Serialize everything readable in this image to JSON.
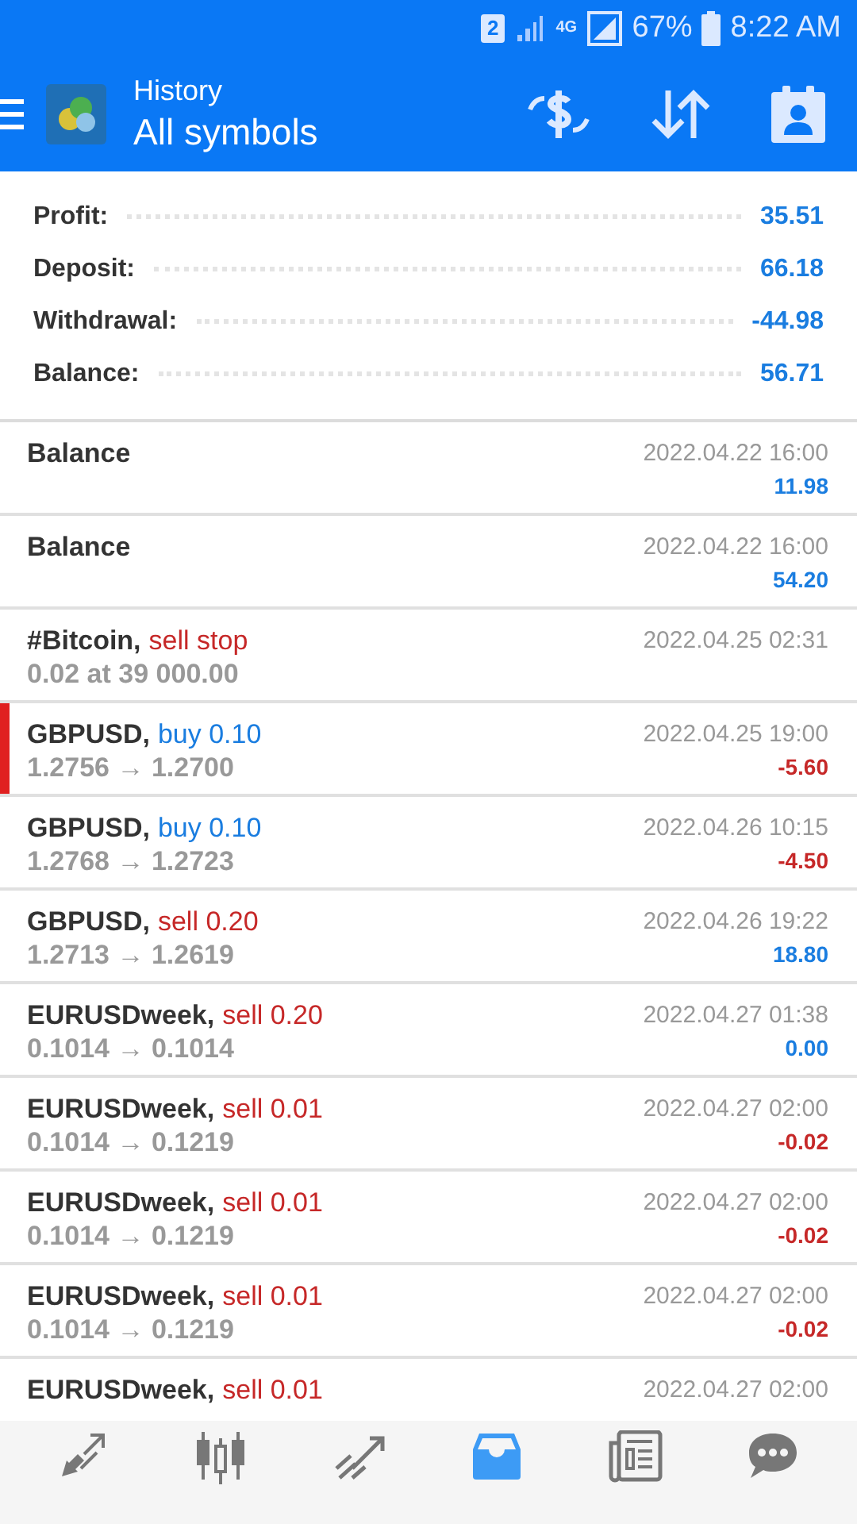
{
  "status_bar": {
    "sim": "2",
    "network": "4G",
    "battery": "67%",
    "time": "8:22 AM"
  },
  "header": {
    "subtitle": "History",
    "title": "All symbols"
  },
  "summary": [
    {
      "label": "Profit:",
      "value": "35.51",
      "negative": false
    },
    {
      "label": "Deposit:",
      "value": "66.18",
      "negative": false
    },
    {
      "label": "Withdrawal:",
      "value": "-44.98",
      "negative": false
    },
    {
      "label": "Balance:",
      "value": "56.71",
      "negative": false
    }
  ],
  "rows": [
    {
      "kind": "balance",
      "symbol": "Balance",
      "time": "2022.04.22 16:00",
      "amount": "11.98",
      "negative": false,
      "selected": false
    },
    {
      "kind": "balance",
      "symbol": "Balance",
      "time": "2022.04.22 16:00",
      "amount": "54.20",
      "negative": false,
      "selected": false
    },
    {
      "kind": "order",
      "symbol": "#Bitcoin,",
      "buy": false,
      "action": "sell stop",
      "details": "0.02 at 39 000.00",
      "time": "2022.04.25 02:31",
      "selected": false
    },
    {
      "kind": "deal",
      "symbol": "GBPUSD,",
      "buy": true,
      "action": "buy 0.10",
      "details": "1.2756 → 1.2700",
      "time": "2022.04.25 19:00",
      "amount": "-5.60",
      "negative": true,
      "selected": true
    },
    {
      "kind": "deal",
      "symbol": "GBPUSD,",
      "buy": true,
      "action": "buy 0.10",
      "details": "1.2768 → 1.2723",
      "time": "2022.04.26 10:15",
      "amount": "-4.50",
      "negative": true,
      "selected": false
    },
    {
      "kind": "deal",
      "symbol": "GBPUSD,",
      "buy": false,
      "action": "sell 0.20",
      "details": "1.2713 → 1.2619",
      "time": "2022.04.26 19:22",
      "amount": "18.80",
      "negative": false,
      "selected": false
    },
    {
      "kind": "deal",
      "symbol": "EURUSDweek,",
      "buy": false,
      "action": "sell 0.20",
      "details": "0.1014 → 0.1014",
      "time": "2022.04.27 01:38",
      "amount": "0.00",
      "negative": false,
      "selected": false
    },
    {
      "kind": "deal",
      "symbol": "EURUSDweek,",
      "buy": false,
      "action": "sell 0.01",
      "details": "0.1014 → 0.1219",
      "time": "2022.04.27 02:00",
      "amount": "-0.02",
      "negative": true,
      "selected": false
    },
    {
      "kind": "deal",
      "symbol": "EURUSDweek,",
      "buy": false,
      "action": "sell 0.01",
      "details": "0.1014 → 0.1219",
      "time": "2022.04.27 02:00",
      "amount": "-0.02",
      "negative": true,
      "selected": false
    },
    {
      "kind": "deal",
      "symbol": "EURUSDweek,",
      "buy": false,
      "action": "sell 0.01",
      "details": "0.1014 → 0.1219",
      "time": "2022.04.27 02:00",
      "amount": "-0.02",
      "negative": true,
      "selected": false
    },
    {
      "kind": "deal",
      "symbol": "EURUSDweek,",
      "buy": false,
      "action": "sell 0.01",
      "time": "2022.04.27 02:00",
      "selected": false
    }
  ],
  "nav": [
    {
      "selected": false
    },
    {
      "selected": false
    },
    {
      "selected": false
    },
    {
      "selected": true
    },
    {
      "selected": false
    },
    {
      "selected": false
    }
  ]
}
